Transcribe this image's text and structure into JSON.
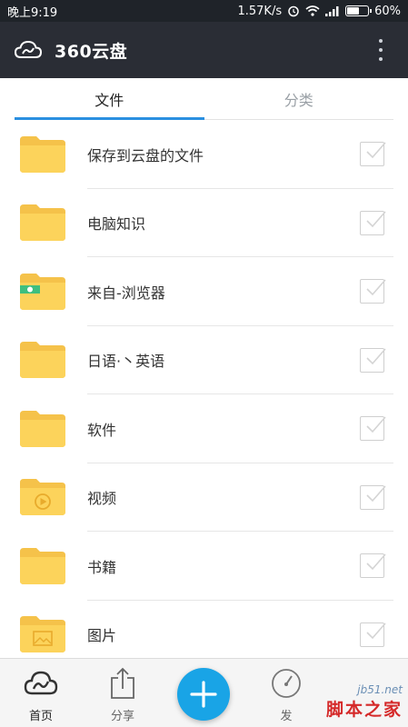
{
  "status_bar": {
    "time": "晚上9:19",
    "network_speed": "1.57K/s",
    "battery_percent": "60%",
    "battery_level": 0.6,
    "icons": [
      "alarm-icon",
      "wifi-icon",
      "signal-icon",
      "battery-icon"
    ]
  },
  "app_bar": {
    "title": "360云盘",
    "logo_icon": "cloud-icon",
    "menu_icon": "more-vert-icon"
  },
  "tabs": [
    {
      "label": "文件",
      "active": true
    },
    {
      "label": "分类",
      "active": false
    }
  ],
  "files": [
    {
      "name": "保存到云盘的文件",
      "icon": "folder-icon",
      "checked": false
    },
    {
      "name": "电脑知识",
      "icon": "folder-icon",
      "checked": false
    },
    {
      "name": "来自-浏览器",
      "icon": "browser-folder-icon",
      "checked": false
    },
    {
      "name": "日语·丶英语",
      "icon": "folder-icon",
      "checked": false
    },
    {
      "name": "软件",
      "icon": "folder-icon",
      "checked": false
    },
    {
      "name": "视频",
      "icon": "video-folder-icon",
      "checked": false
    },
    {
      "name": "书籍",
      "icon": "folder-icon",
      "checked": false
    },
    {
      "name": "图片",
      "icon": "image-folder-icon",
      "checked": false
    }
  ],
  "bottom_nav": {
    "home_label": "首页",
    "share_label": "分享",
    "discover_label": "发",
    "add_icon": "plus-icon"
  },
  "watermark": {
    "url": "jb51.net",
    "text": "脚本之家"
  },
  "colors": {
    "status_bar": "#1f2329",
    "app_bar": "#2a2d35",
    "accent": "#2a8fe0",
    "fab": "#19a4e6",
    "folder": "#fcd35b"
  }
}
